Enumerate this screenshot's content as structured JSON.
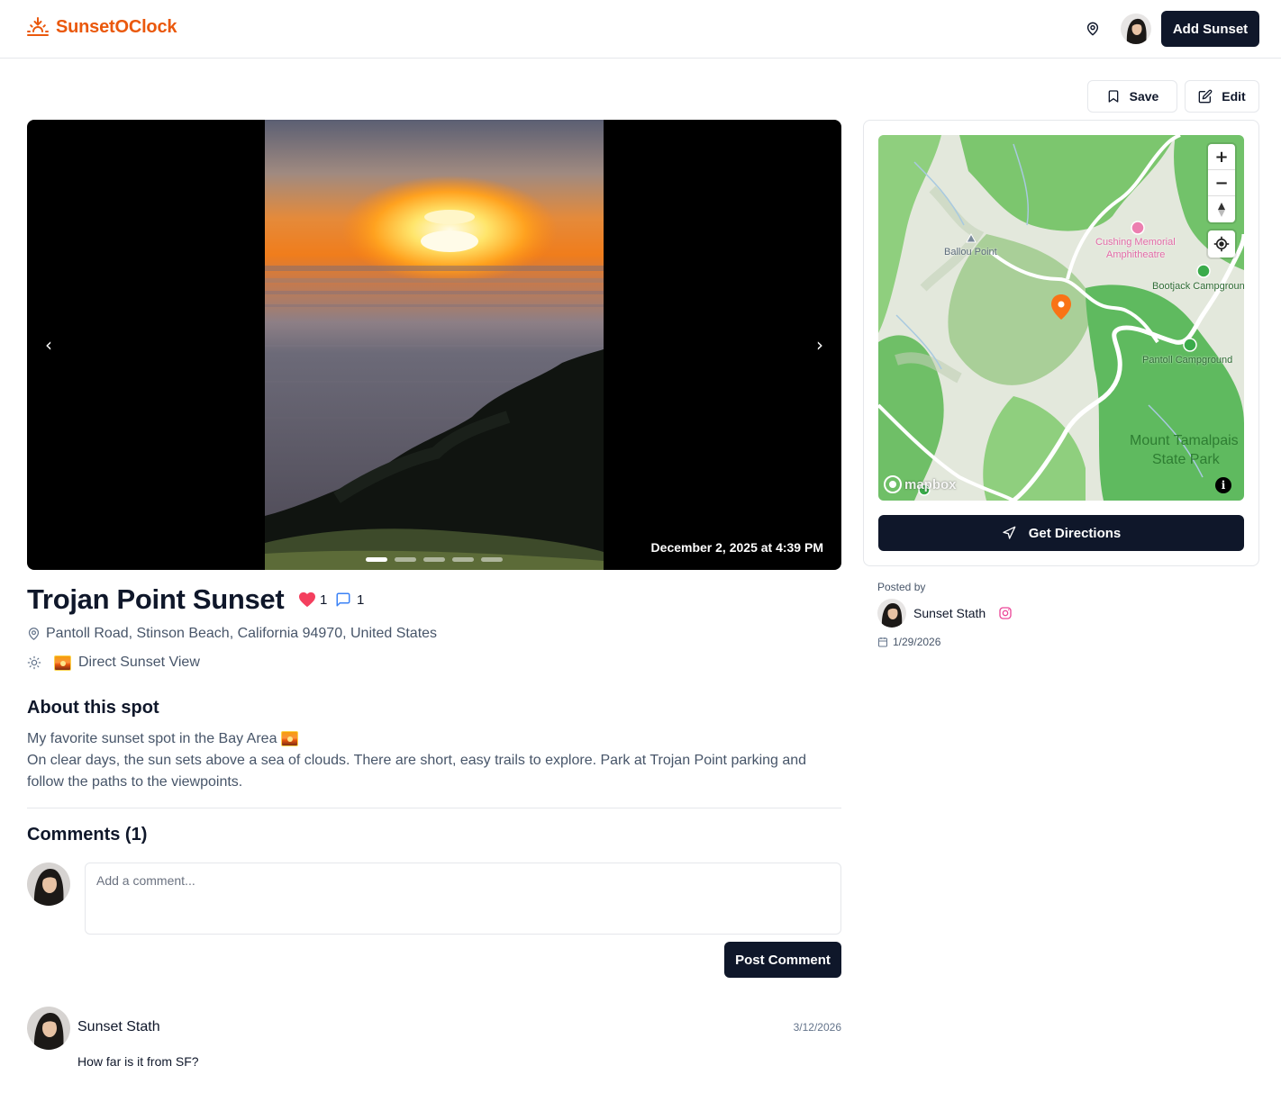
{
  "header": {
    "brand": "SunsetOClock",
    "add_sunset": "Add Sunset"
  },
  "actions": {
    "save": "Save",
    "edit": "Edit"
  },
  "carousel": {
    "date": "December 2, 2025 at 4:39 PM",
    "slide_count": 5,
    "active_slide": 1,
    "prev": "‹",
    "next": "›"
  },
  "spot": {
    "title": "Trojan Point Sunset",
    "likes": "1",
    "comments": "1",
    "address": "Pantoll Road, Stinson Beach, California 94970, United States",
    "view_type": "Direct Sunset View"
  },
  "about": {
    "heading": "About this spot",
    "line1": "My favorite sunset spot in the Bay Area",
    "line2": "On clear days, the sun sets above a sea of clouds. There are short, easy trails to explore. Park at Trojan Point parking and follow the paths to the viewpoints."
  },
  "comments": {
    "heading": "Comments (1)",
    "placeholder": "Add a comment...",
    "post_button": "Post Comment",
    "items": [
      {
        "author": "Sunset Stath",
        "date": "3/12/2026",
        "text": "How far is it from SF?"
      }
    ]
  },
  "map": {
    "labels": {
      "ballou": "Ballou Point",
      "cushing1": "Cushing Memorial",
      "cushing2": "Amphitheatre",
      "bootjack": "Bootjack Campground",
      "pantoll": "Pantoll Campground",
      "park1": "Mount Tamalpais",
      "park2": "State Park"
    },
    "logo": "mapbox",
    "zoom_in": "+",
    "zoom_out": "−",
    "info": "i",
    "directions": "Get Directions"
  },
  "poster": {
    "label": "Posted by",
    "name": "Sunset Stath",
    "date": "1/29/2026"
  },
  "colors": {
    "brand": "#ea580c",
    "primary": "#0f172a",
    "like": "#f43f5e",
    "comment": "#3b82f6",
    "instagram": "#ec4899"
  }
}
